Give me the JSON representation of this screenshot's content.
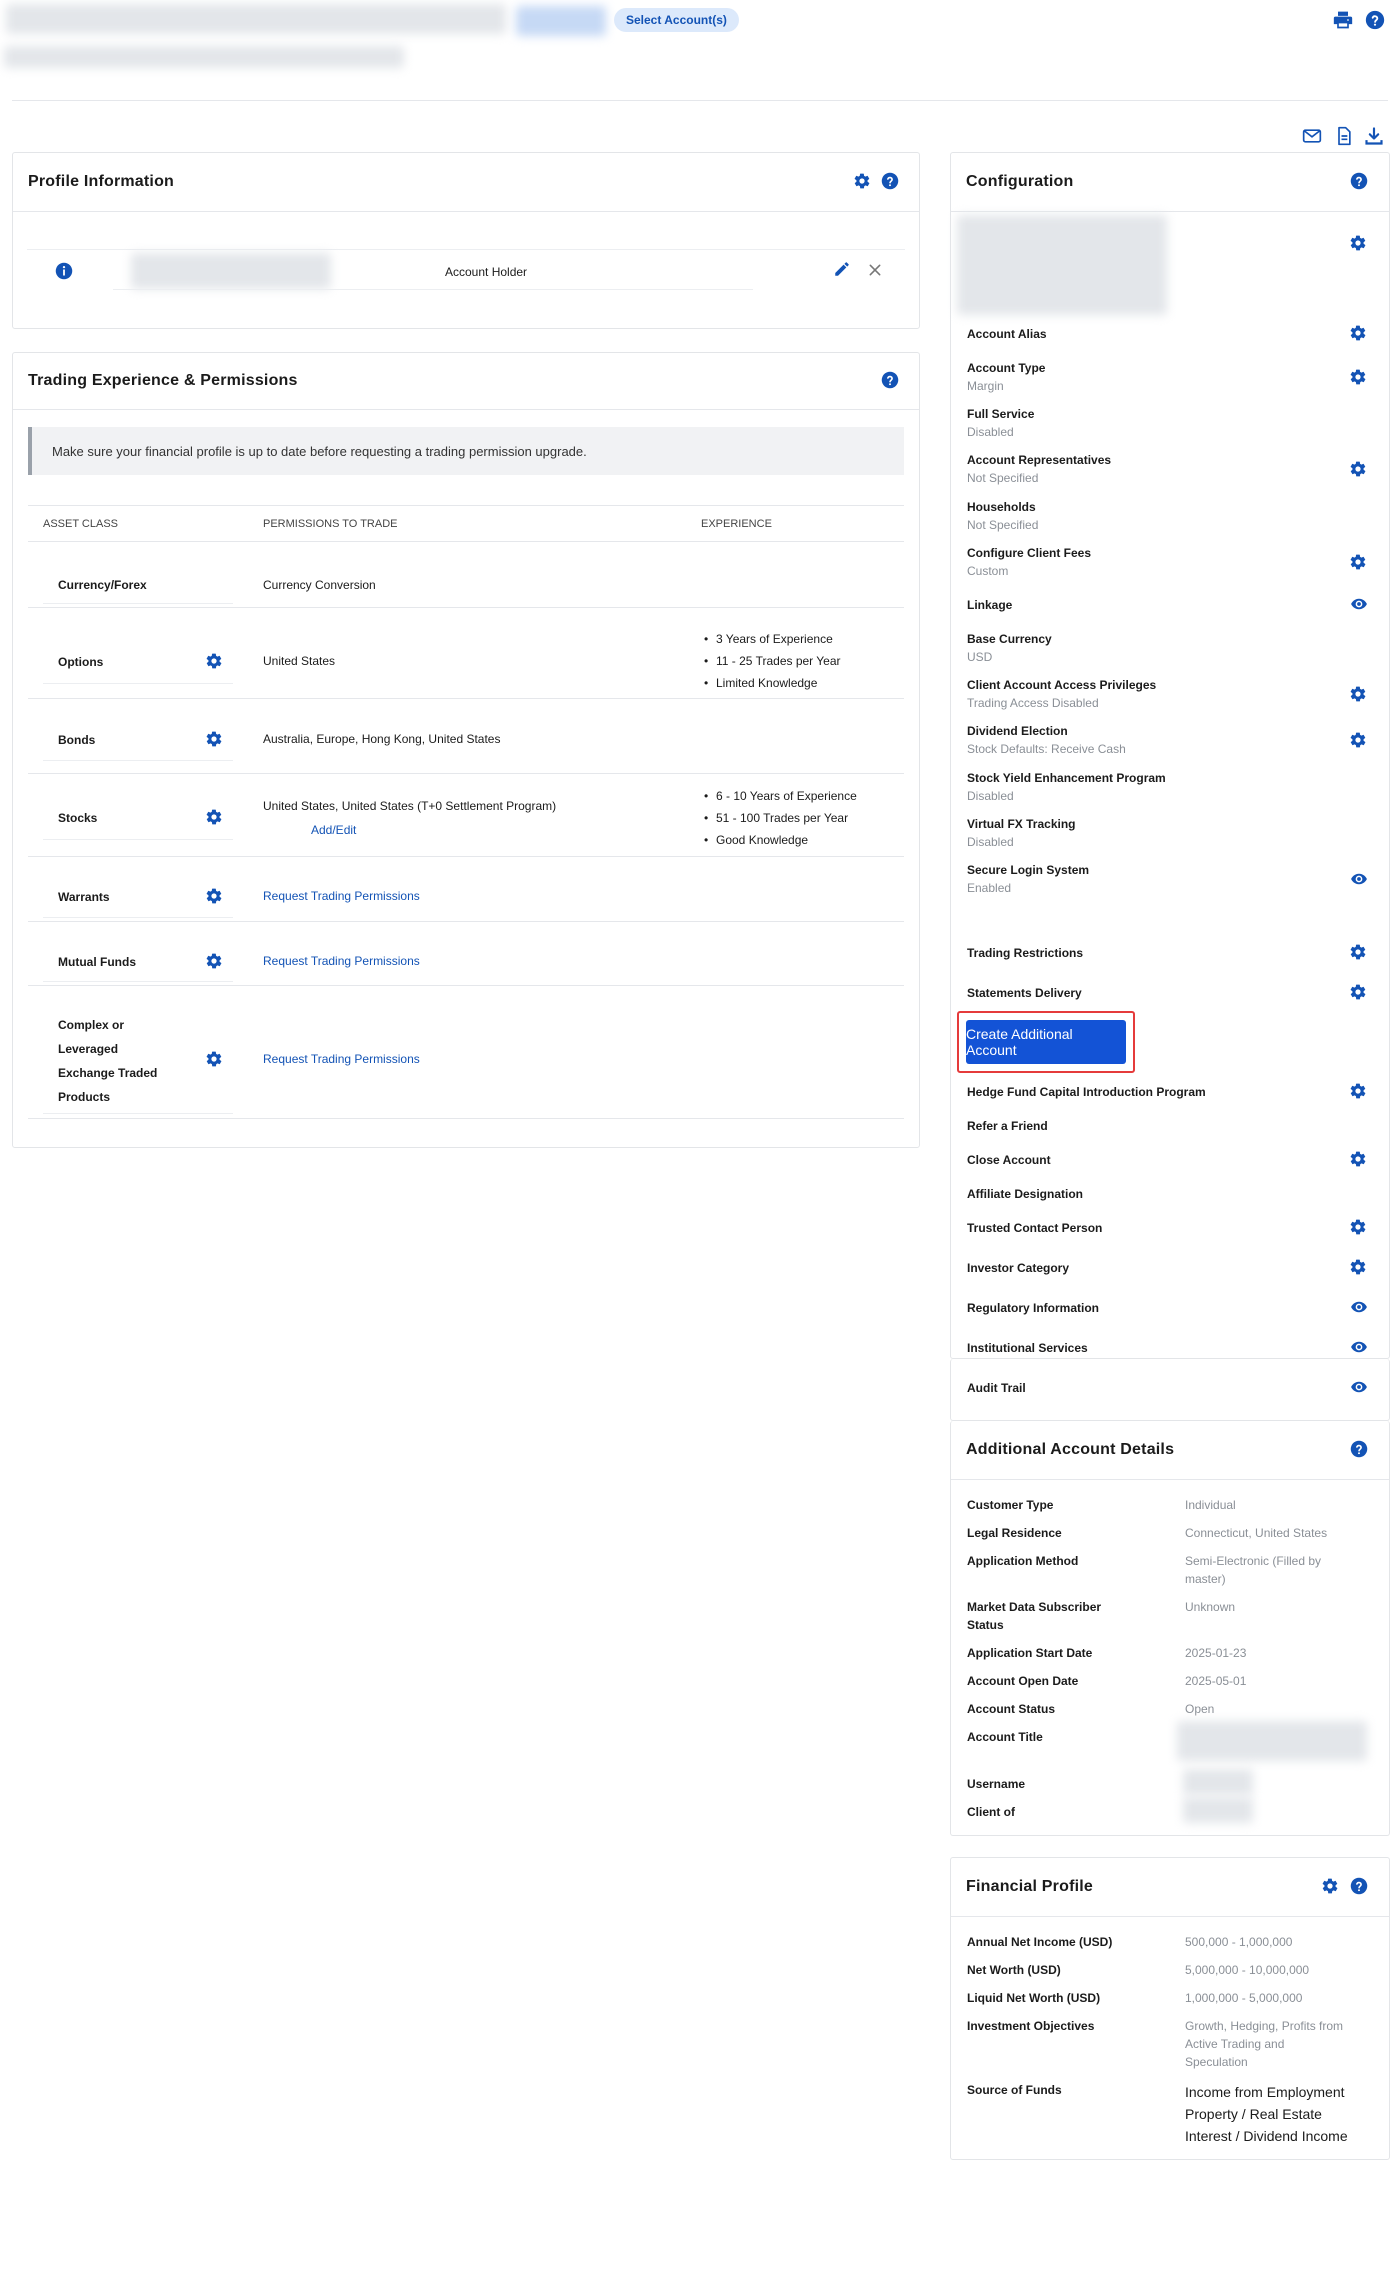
{
  "header": {
    "select_accounts": "Select Account(s)",
    "icons": [
      "printer-icon",
      "help-icon",
      "mail-icon",
      "document-icon",
      "download-icon"
    ]
  },
  "profile": {
    "title": "Profile Information",
    "row_role": "Account Holder"
  },
  "trading": {
    "title": "Trading Experience & Permissions",
    "banner": "Make sure your financial profile is up to date before requesting a trading permission upgrade.",
    "columns": [
      "Asset Class",
      "Permissions to Trade",
      "Experience"
    ],
    "rows": [
      {
        "asset": "Currency/Forex",
        "permission": "Currency Conversion"
      },
      {
        "asset": "Options",
        "permission": "United States",
        "experience": [
          "3 Years of Experience",
          "11 - 25 Trades per Year",
          "Limited Knowledge"
        ]
      },
      {
        "asset": "Bonds",
        "permission": "Australia, Europe, Hong Kong, United States"
      },
      {
        "asset": "Stocks",
        "permission": "United States, United States (T+0 Settlement Program)",
        "link": "Add/Edit",
        "experience": [
          "6 - 10 Years of Experience",
          "51 - 100 Trades per Year",
          "Good Knowledge"
        ]
      },
      {
        "asset": "Warrants",
        "permission": "Request Trading Permissions"
      },
      {
        "asset": "Mutual Funds",
        "permission": "Request Trading Permissions"
      },
      {
        "asset": "Complex or Leveraged Exchange Traded Products",
        "asset_lines": [
          "Complex or",
          "Leveraged",
          "Exchange Traded",
          "Products"
        ],
        "permission": "Request Trading Permissions"
      }
    ]
  },
  "configuration": {
    "title": "Configuration",
    "items": [
      {
        "label": "Account Alias"
      },
      {
        "label": "Account Type",
        "sub": "Margin"
      },
      {
        "label": "Full Service",
        "sub": "Disabled"
      },
      {
        "label": "Account Representatives",
        "sub": "Not Specified"
      },
      {
        "label": "Households",
        "sub": "Not Specified"
      },
      {
        "label": "Configure Client Fees",
        "sub": "Custom"
      },
      {
        "label": "Linkage"
      },
      {
        "label": "Base Currency",
        "sub": "USD"
      },
      {
        "label": "Client Account Access Privileges",
        "sub": "Trading Access Disabled"
      },
      {
        "label": "Dividend Election",
        "sub": "Stock Defaults: Receive Cash"
      },
      {
        "label": "Stock Yield Enhancement Program",
        "sub": "Disabled"
      },
      {
        "label": "Virtual FX Tracking",
        "sub": "Disabled"
      },
      {
        "label": "Secure Login System",
        "sub": "Enabled"
      },
      {
        "label": "Trading Restrictions"
      },
      {
        "label": "Statements Delivery"
      },
      {
        "label": "Hedge Fund Capital Introduction Program"
      },
      {
        "label": "Refer a Friend"
      },
      {
        "label": "Close Account"
      },
      {
        "label": "Affiliate Designation"
      },
      {
        "label": "Trusted Contact Person"
      },
      {
        "label": "Investor Category"
      },
      {
        "label": "Regulatory Information"
      },
      {
        "label": "Institutional Services"
      },
      {
        "label": "Audit Trail"
      }
    ],
    "create_button": "Create Additional Account"
  },
  "additional": {
    "title": "Additional Account Details",
    "rows": [
      {
        "label": "Customer Type",
        "value": "Individual"
      },
      {
        "label": "Legal Residence",
        "value": "Connecticut, United States"
      },
      {
        "label": "Application Method",
        "value_lines": [
          "Semi-Electronic (Filled by",
          "master)"
        ]
      },
      {
        "label_lines": [
          "Market Data Subscriber",
          "Status"
        ],
        "value": "Unknown"
      },
      {
        "label": "Application Start Date",
        "value": "2025-01-23"
      },
      {
        "label": "Account Open Date",
        "value": "2025-05-01"
      },
      {
        "label": "Account Status",
        "value": "Open"
      },
      {
        "label": "Account Title"
      },
      {
        "label": "Username"
      },
      {
        "label": "Client of"
      }
    ]
  },
  "financial": {
    "title": "Financial Profile",
    "rows": [
      {
        "label": "Annual Net Income (USD)",
        "value": "500,000 - 1,000,000"
      },
      {
        "label": "Net Worth (USD)",
        "value": "5,000,000 - 10,000,000"
      },
      {
        "label": "Liquid Net Worth (USD)",
        "value": "1,000,000 - 5,000,000"
      },
      {
        "label": "Investment Objectives",
        "value_lines": [
          "Growth, Hedging, Profits from",
          "Active Trading and",
          "Speculation"
        ]
      },
      {
        "label": "Source of Funds",
        "value_lines": [
          "Income from Employment",
          "Property / Real Estate",
          "Interest / Dividend Income"
        ]
      }
    ]
  }
}
